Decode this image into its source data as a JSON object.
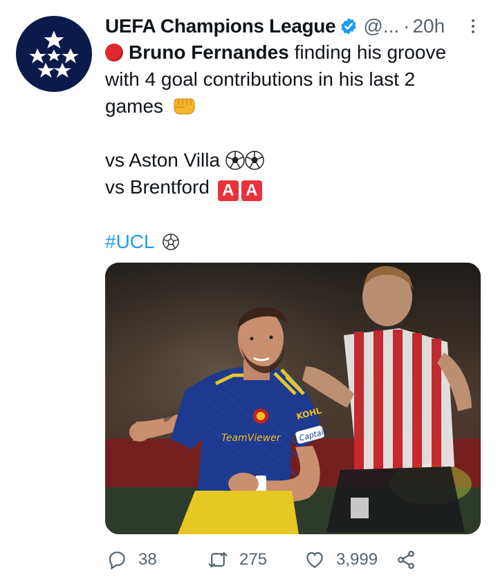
{
  "tweet": {
    "author_name": "UEFA Champions League",
    "handle": "@...",
    "separator": "·",
    "time": "20h",
    "avatar_icon": "starball-logo",
    "verified_icon": "verified-badge-icon",
    "text": {
      "bold_name": "Bruno Fernandes",
      "line1_rest": " finding his groove",
      "line2": "with 4 goal contributions in his last 2",
      "line3": "games",
      "line4": "vs Aston Villa",
      "line5": "vs Brentford",
      "assist_letter": "A",
      "hashtag": "#UCL"
    },
    "image": {
      "kit_sponsor": "TeamViewer",
      "sleeve_text": "KOHL",
      "armband_text": "Captain"
    },
    "actions": {
      "reply_count": "38",
      "retweet_count": "275",
      "like_count": "3,999"
    }
  },
  "colors": {
    "link": "#1d9bf0",
    "muted": "#536471",
    "avatar_bg": "#0a1a4a"
  }
}
